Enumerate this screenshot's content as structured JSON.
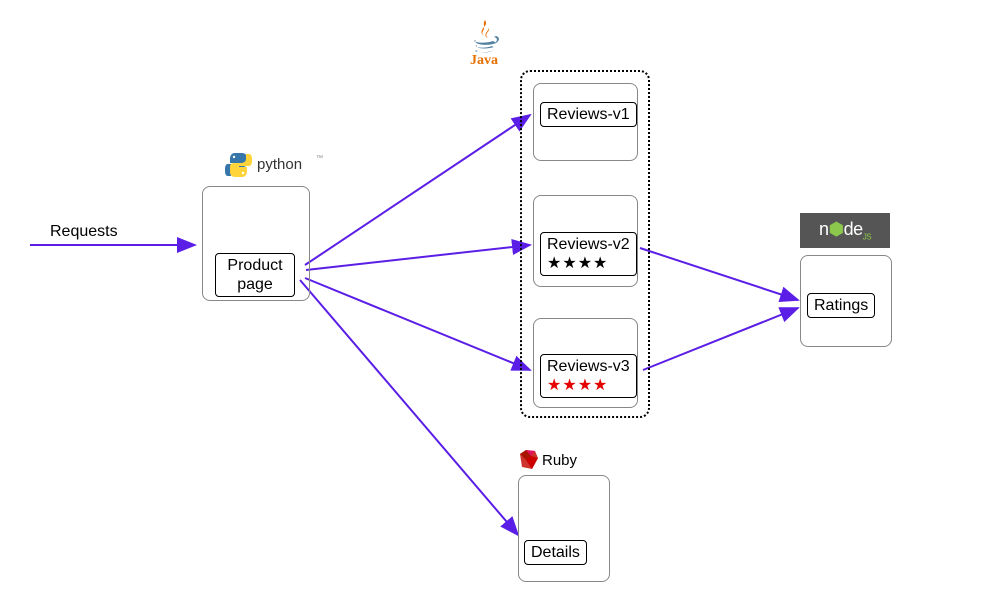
{
  "requests_label": "Requests",
  "product_page": {
    "label": "Product\npage"
  },
  "reviews": {
    "v1": {
      "label": "Reviews-v1"
    },
    "v2": {
      "label": "Reviews-v2",
      "stars": "★★★★"
    },
    "v3": {
      "label": "Reviews-v3",
      "stars": "★★★★"
    }
  },
  "ratings": {
    "label": "Ratings"
  },
  "details": {
    "label": "Details"
  },
  "tech_logos": {
    "python": "python",
    "java": "Java",
    "ruby": "Ruby",
    "node": "node"
  }
}
